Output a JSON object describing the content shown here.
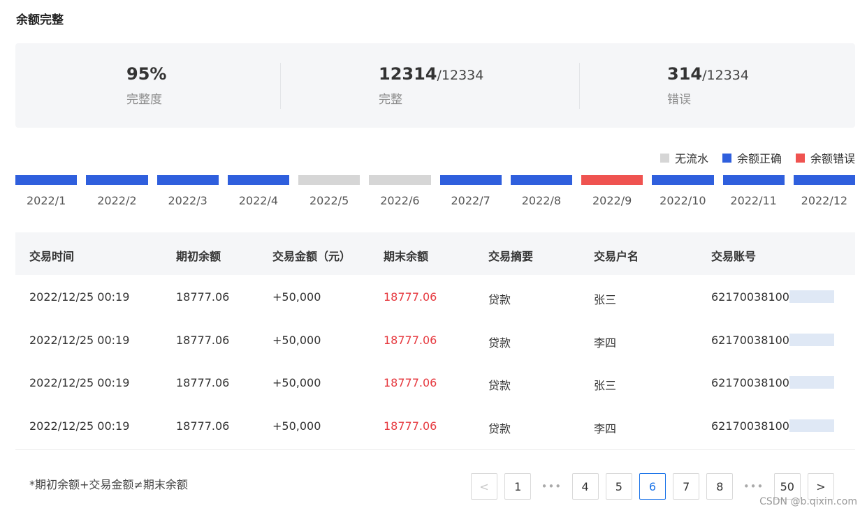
{
  "page": {
    "title": "余额完整"
  },
  "stats": [
    {
      "value": "95%",
      "total": "",
      "label": "完整度"
    },
    {
      "value": "12314",
      "total": "/12334",
      "label": "完整"
    },
    {
      "value": "314",
      "total": "/12334",
      "label": "错误"
    }
  ],
  "legend": [
    {
      "label": "无流水",
      "color": "#d6d6d6"
    },
    {
      "label": "余额正确",
      "color": "#2f5fdd"
    },
    {
      "label": "余额错误",
      "color": "#ef5350"
    }
  ],
  "timeline": [
    {
      "label": "2022/1",
      "status": "ok"
    },
    {
      "label": "2022/2",
      "status": "ok"
    },
    {
      "label": "2022/3",
      "status": "ok"
    },
    {
      "label": "2022/4",
      "status": "ok"
    },
    {
      "label": "2022/5",
      "status": "none"
    },
    {
      "label": "2022/6",
      "status": "none"
    },
    {
      "label": "2022/7",
      "status": "ok"
    },
    {
      "label": "2022/8",
      "status": "ok"
    },
    {
      "label": "2022/9",
      "status": "error"
    },
    {
      "label": "2022/10",
      "status": "ok"
    },
    {
      "label": "2022/11",
      "status": "ok"
    },
    {
      "label": "2022/12",
      "status": "ok"
    }
  ],
  "table": {
    "headers": [
      "交易时间",
      "期初余额",
      "交易金额（元）",
      "期末余额",
      "交易摘要",
      "交易户名",
      "交易账号"
    ],
    "rows": [
      [
        "2022/12/25 00:19",
        "18777.06",
        "+50,000",
        "18777.06",
        "贷款",
        "张三",
        "621700381003"
      ],
      [
        "2022/12/25 00:19",
        "18777.06",
        "+50,000",
        "18777.06",
        "贷款",
        "李四",
        "621700381003"
      ],
      [
        "2022/12/25 00:19",
        "18777.06",
        "+50,000",
        "18777.06",
        "贷款",
        "张三",
        "621700381003"
      ],
      [
        "2022/12/25 00:19",
        "18777.06",
        "+50,000",
        "18777.06",
        "贷款",
        "李四",
        "621700381003"
      ]
    ]
  },
  "footnote": "*期初余额+交易金额≠期末余额",
  "pagination": {
    "prev": "<",
    "next": ">",
    "ellipsis": "•••",
    "pages": [
      "1",
      "4",
      "5",
      "6",
      "7",
      "8",
      "50"
    ],
    "current": "6"
  },
  "watermark": "CSDN @b.qixin.com"
}
